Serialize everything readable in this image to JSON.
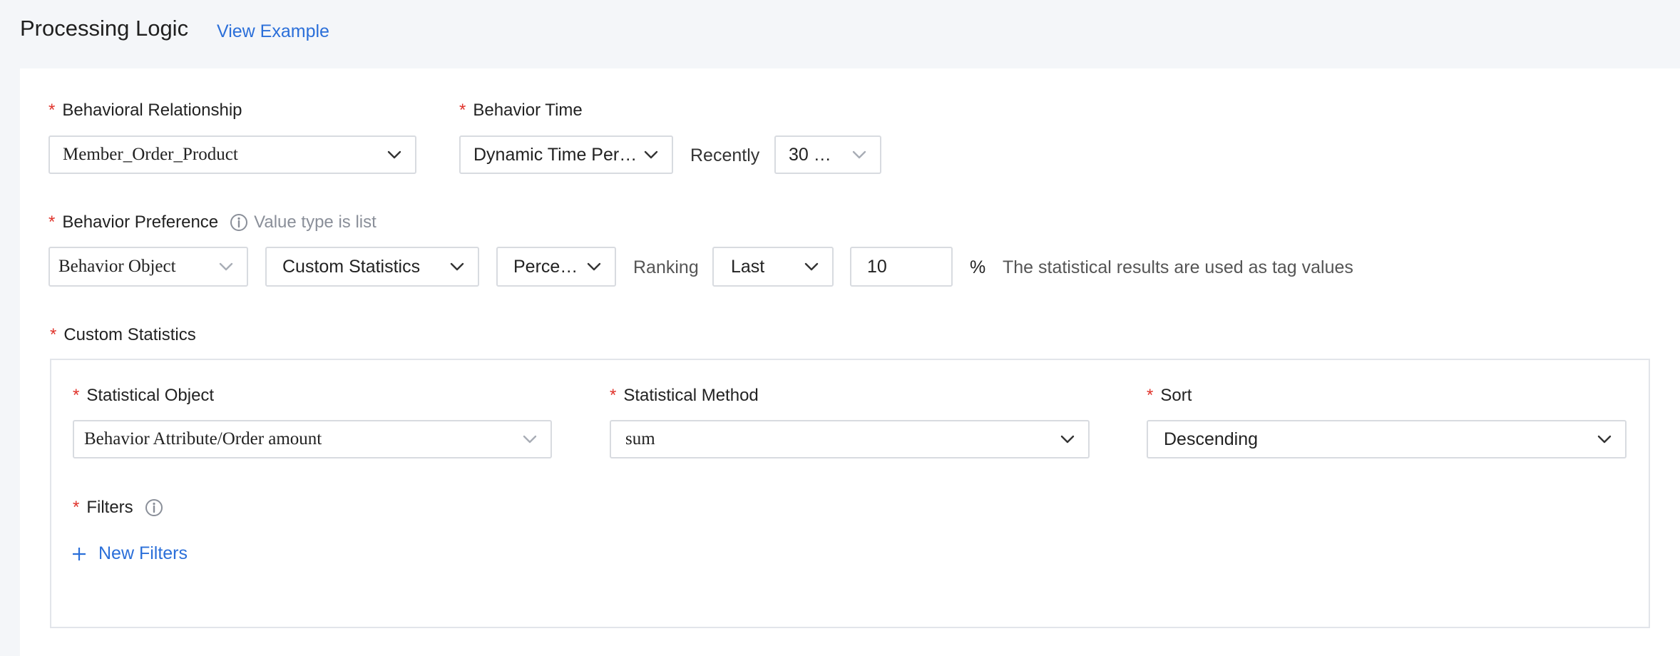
{
  "header": {
    "title": "Processing Logic",
    "view_example": "View Example"
  },
  "behavioral_relationship": {
    "label": "Behavioral Relationship",
    "value": "Member_Order_Product"
  },
  "behavior_time": {
    "label": "Behavior Time",
    "mode_value": "Dynamic Time Per…",
    "recently_label": "Recently",
    "period_value": "30 …"
  },
  "behavior_preference": {
    "label": "Behavior Preference",
    "hint": "Value type is list",
    "object_value": "Behavior Object",
    "statistics_value": "Custom Statistics",
    "metric_value": "Perce…",
    "ranking_label": "Ranking",
    "position_value": "Last",
    "amount_value": "10",
    "unit": "%",
    "note": "The statistical results are used as tag values"
  },
  "custom_statistics": {
    "label": "Custom Statistics",
    "statistical_object": {
      "label": "Statistical Object",
      "value": "Behavior Attribute/Order amount"
    },
    "statistical_method": {
      "label": "Statistical Method",
      "value": "sum"
    },
    "sort": {
      "label": "Sort",
      "value": "Descending"
    },
    "filters": {
      "label": "Filters",
      "new_filters": "New Filters"
    }
  },
  "icons": {
    "chevron": "chevron-down-icon",
    "info": "info-icon",
    "plus": "plus-icon"
  },
  "colors": {
    "accent": "#2b6fd9",
    "required": "#e0332b",
    "background": "#f4f6f9"
  }
}
